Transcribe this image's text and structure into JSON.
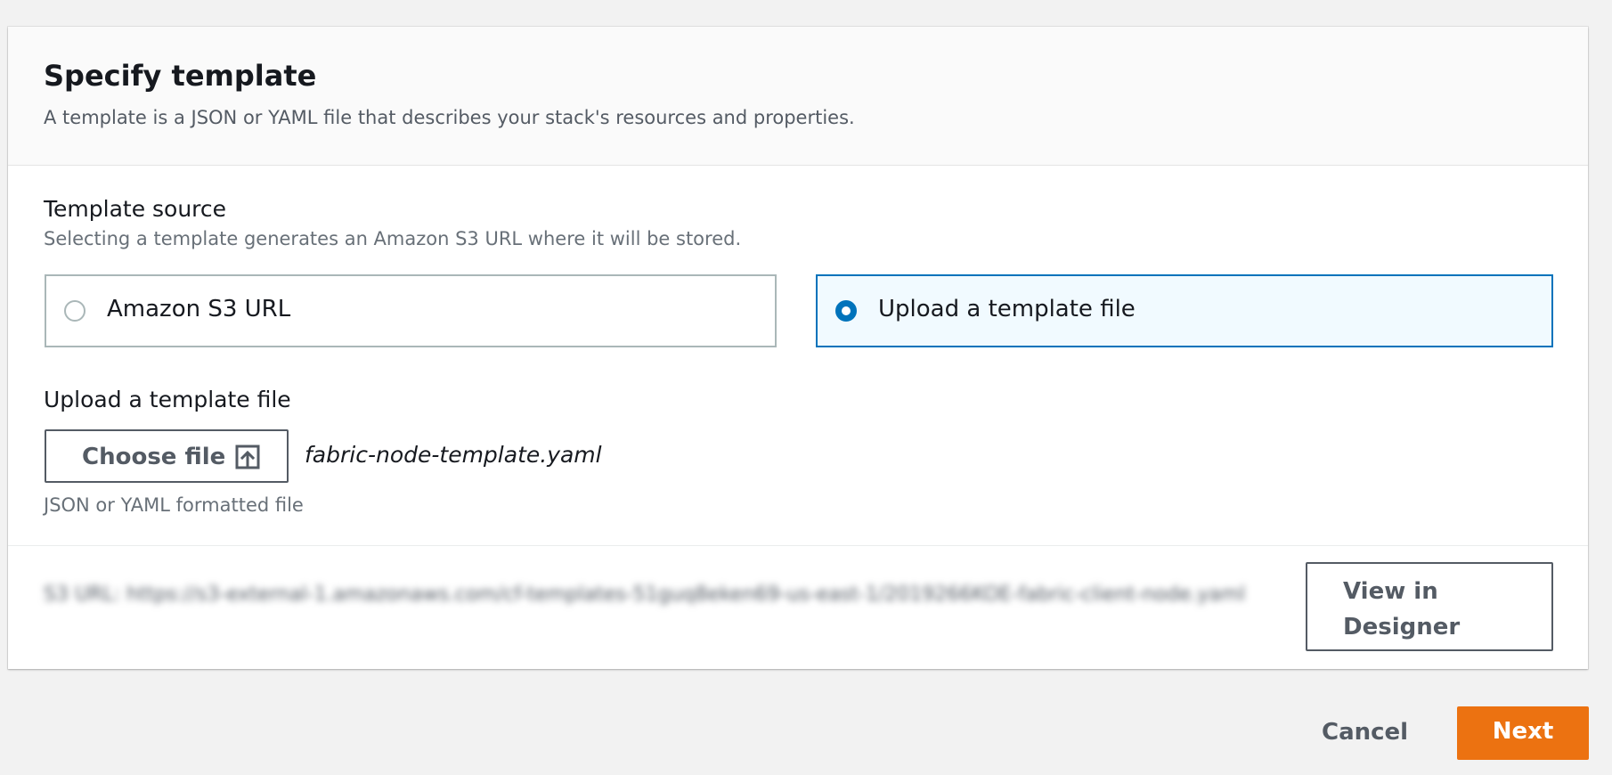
{
  "panel": {
    "title": "Specify template",
    "description": "A template is a JSON or YAML file that describes your stack's resources and properties."
  },
  "template_source": {
    "label": "Template source",
    "description": "Selecting a template generates an Amazon S3 URL where it will be stored.",
    "options": [
      {
        "label": "Amazon S3 URL",
        "selected": false
      },
      {
        "label": "Upload a template file",
        "selected": true
      }
    ]
  },
  "upload": {
    "label": "Upload a template file",
    "choose_file_label": "Choose file",
    "choose_file_icon": "upload-icon",
    "file_name": "fabric-node-template.yaml",
    "constraint": "JSON or YAML formatted file"
  },
  "s3_url": {
    "text": "S3 URL: https://s3-external-1.amazonaws.com/cf-templates-51guq8eken69-us-east-1/2019266KOE-fabric-client-node.yaml"
  },
  "view_in_designer_label": "View in Designer",
  "footer": {
    "cancel_label": "Cancel",
    "next_label": "Next"
  },
  "colors": {
    "accent_blue": "#0073bb",
    "selected_tile_bg": "#f1faff",
    "primary_button": "#ec7211",
    "page_bg": "#f2f2f2"
  }
}
